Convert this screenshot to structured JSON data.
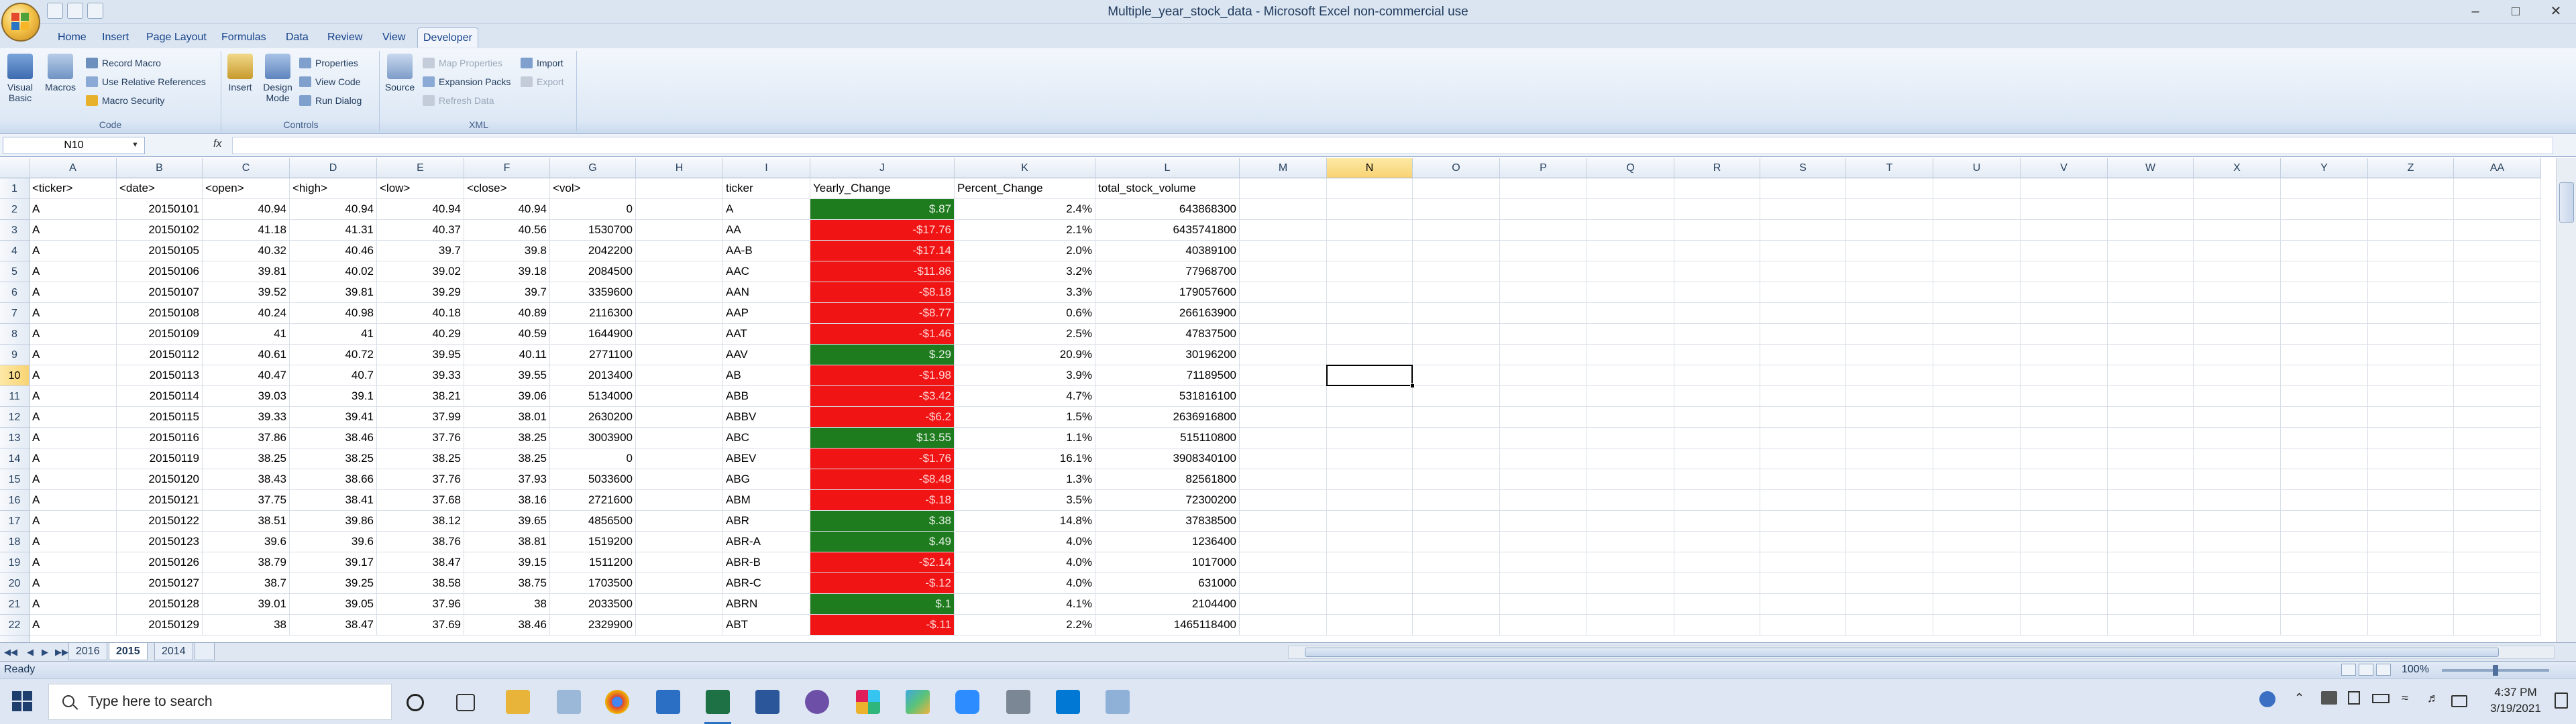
{
  "window": {
    "title": "Multiple_year_stock_data - Microsoft Excel non-commercial use",
    "controls": [
      "–",
      "□",
      "✕"
    ]
  },
  "ribbon_tabs": [
    "Home",
    "Insert",
    "Page Layout",
    "Formulas",
    "Data",
    "Review",
    "View",
    "Developer"
  ],
  "active_tab": "Developer",
  "ribbon": {
    "code": {
      "label": "Code",
      "visual_basic": "Visual Basic",
      "macros": "Macros",
      "record_macro": "Record Macro",
      "relative_refs": "Use Relative References",
      "macro_security": "Macro Security"
    },
    "controls": {
      "label": "Controls",
      "insert": "Insert",
      "design_mode": "Design Mode",
      "properties": "Properties",
      "view_code": "View Code",
      "run_dialog": "Run Dialog"
    },
    "xml": {
      "label": "XML",
      "source": "Source",
      "map_properties": "Map Properties",
      "expansion_packs": "Expansion Packs",
      "refresh_data": "Refresh Data",
      "import": "Import",
      "export": "Export"
    }
  },
  "formula_bar": {
    "name_box": "N10",
    "fx": "fx",
    "formula": ""
  },
  "grid": {
    "columns": [
      "A",
      "B",
      "C",
      "D",
      "E",
      "F",
      "G",
      "H",
      "I",
      "J",
      "K",
      "L",
      "M",
      "N",
      "O",
      "P",
      "Q",
      "R",
      "S",
      "T",
      "U",
      "V",
      "W",
      "X",
      "Y",
      "Z",
      "AA"
    ],
    "selected_column": "N",
    "selected_row": "10",
    "row_numbers": [
      "1",
      "2",
      "3",
      "4",
      "5",
      "6",
      "7",
      "8",
      "9",
      "10",
      "11",
      "12",
      "13",
      "14",
      "15",
      "16",
      "17",
      "18",
      "19",
      "20",
      "21",
      "22"
    ],
    "header_row": [
      "<ticker>",
      "<date>",
      "<open>",
      "<high>",
      "<low>",
      "<close>",
      "<vol>",
      "",
      "ticker",
      "Yearly_Change",
      "Percent_Change",
      "total_stock_volume"
    ],
    "rows": [
      [
        "A",
        "20150101",
        "40.94",
        "40.94",
        "40.94",
        "40.94",
        "0",
        "",
        "A",
        "$.87",
        "2.4%",
        "643868300"
      ],
      [
        "A",
        "20150102",
        "41.18",
        "41.31",
        "40.37",
        "40.56",
        "1530700",
        "",
        "AA",
        "-$17.76",
        "2.1%",
        "6435741800"
      ],
      [
        "A",
        "20150105",
        "40.32",
        "40.46",
        "39.7",
        "39.8",
        "2042200",
        "",
        "AA-B",
        "-$17.14",
        "2.0%",
        "40389100"
      ],
      [
        "A",
        "20150106",
        "39.81",
        "40.02",
        "39.02",
        "39.18",
        "2084500",
        "",
        "AAC",
        "-$11.86",
        "3.2%",
        "77968700"
      ],
      [
        "A",
        "20150107",
        "39.52",
        "39.81",
        "39.29",
        "39.7",
        "3359600",
        "",
        "AAN",
        "-$8.18",
        "3.3%",
        "179057600"
      ],
      [
        "A",
        "20150108",
        "40.24",
        "40.98",
        "40.18",
        "40.89",
        "2116300",
        "",
        "AAP",
        "-$8.77",
        "0.6%",
        "266163900"
      ],
      [
        "A",
        "20150109",
        "41",
        "41",
        "40.29",
        "40.59",
        "1644900",
        "",
        "AAT",
        "-$1.46",
        "2.5%",
        "47837500"
      ],
      [
        "A",
        "20150112",
        "40.61",
        "40.72",
        "39.95",
        "40.11",
        "2771100",
        "",
        "AAV",
        "$.29",
        "20.9%",
        "30196200"
      ],
      [
        "A",
        "20150113",
        "40.47",
        "40.7",
        "39.33",
        "39.55",
        "2013400",
        "",
        "AB",
        "-$1.98",
        "3.9%",
        "71189500"
      ],
      [
        "A",
        "20150114",
        "39.03",
        "39.1",
        "38.21",
        "39.06",
        "5134000",
        "",
        "ABB",
        "-$3.42",
        "4.7%",
        "531816100"
      ],
      [
        "A",
        "20150115",
        "39.33",
        "39.41",
        "37.99",
        "38.01",
        "2630200",
        "",
        "ABBV",
        "-$6.2",
        "1.5%",
        "2636916800"
      ],
      [
        "A",
        "20150116",
        "37.86",
        "38.46",
        "37.76",
        "38.25",
        "3003900",
        "",
        "ABC",
        "$13.55",
        "1.1%",
        "515110800"
      ],
      [
        "A",
        "20150119",
        "38.25",
        "38.25",
        "38.25",
        "38.25",
        "0",
        "",
        "ABEV",
        "-$1.76",
        "16.1%",
        "3908340100"
      ],
      [
        "A",
        "20150120",
        "38.43",
        "38.66",
        "37.76",
        "37.93",
        "5033600",
        "",
        "ABG",
        "-$8.48",
        "1.3%",
        "82561800"
      ],
      [
        "A",
        "20150121",
        "37.75",
        "38.41",
        "37.68",
        "38.16",
        "2721600",
        "",
        "ABM",
        "-$.18",
        "3.5%",
        "72300200"
      ],
      [
        "A",
        "20150122",
        "38.51",
        "39.86",
        "38.12",
        "39.65",
        "4856500",
        "",
        "ABR",
        "$.38",
        "14.8%",
        "37838500"
      ],
      [
        "A",
        "20150123",
        "39.6",
        "39.6",
        "38.76",
        "38.81",
        "1519200",
        "",
        "ABR-A",
        "$.49",
        "4.0%",
        "1236400"
      ],
      [
        "A",
        "20150126",
        "38.79",
        "39.17",
        "38.47",
        "39.15",
        "1511200",
        "",
        "ABR-B",
        "-$2.14",
        "4.0%",
        "1017000"
      ],
      [
        "A",
        "20150127",
        "38.7",
        "39.25",
        "38.58",
        "38.75",
        "1703500",
        "",
        "ABR-C",
        "-$.12",
        "4.0%",
        "631000"
      ],
      [
        "A",
        "20150128",
        "39.01",
        "39.05",
        "37.96",
        "38",
        "2033500",
        "",
        "ABRN",
        "$.1",
        "4.1%",
        "2104400"
      ],
      [
        "A",
        "20150129",
        "38",
        "38.47",
        "37.69",
        "38.46",
        "2329900",
        "",
        "ABT",
        "-$.11",
        "2.2%",
        "1465118400"
      ]
    ],
    "change_sign": [
      "pos",
      "neg",
      "neg",
      "neg",
      "neg",
      "neg",
      "neg",
      "pos",
      "neg",
      "neg",
      "neg",
      "pos",
      "neg",
      "neg",
      "neg",
      "pos",
      "pos",
      "neg",
      "neg",
      "pos",
      "neg"
    ]
  },
  "sheets": [
    "2016",
    "2015",
    "2014"
  ],
  "active_sheet": "2015",
  "status": {
    "ready": "Ready",
    "zoom": "100%"
  },
  "taskbar": {
    "search_placeholder": "Type here to search",
    "time": "4:37 PM",
    "date": "3/19/2021"
  },
  "colors": {
    "positive": "#1e7b1e",
    "negative": "#f01414",
    "selection": "#f8d373"
  }
}
